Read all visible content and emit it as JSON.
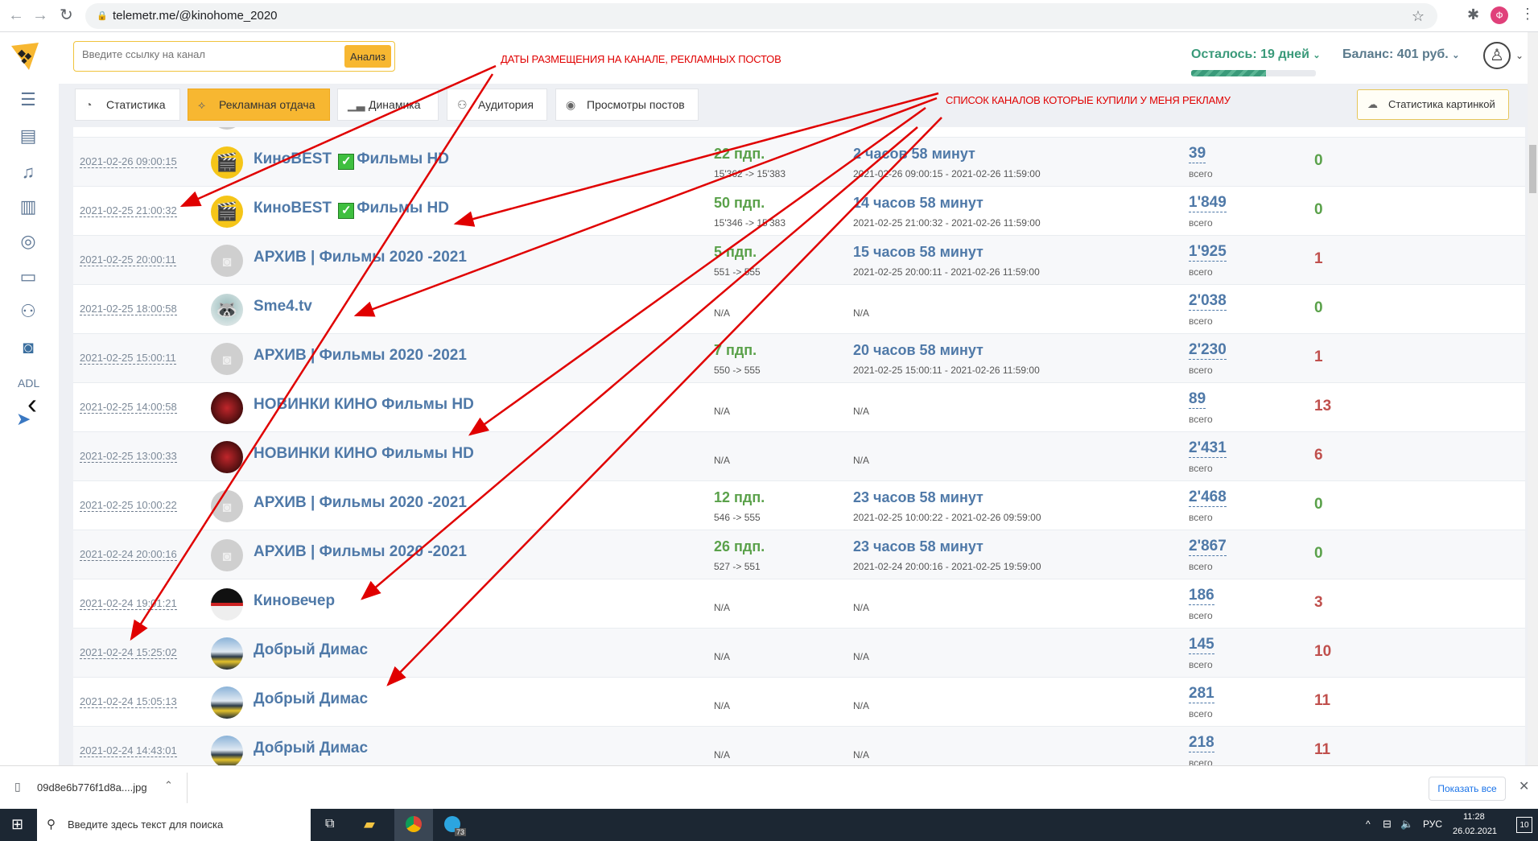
{
  "browser": {
    "url": "telemetr.me/@kinohome_2020",
    "profile_initial": "Ф"
  },
  "sidebar": {
    "icons": [
      "list-icon",
      "clipboard-icon",
      "bell-icon",
      "inbox-archive-icon",
      "user-circle-icon",
      "tray-icon",
      "users-icon",
      "instagram-icon"
    ],
    "adl_label": "ADL"
  },
  "header": {
    "search_placeholder": "Введите ссылку на канал",
    "analyze_label": "Анализ",
    "days_left": "Осталось: 19 дней",
    "days_progress_percent": 60,
    "balance": "Баланс: 401 руб."
  },
  "tabs": [
    {
      "label": "Статистика",
      "icon": "speedometer-icon"
    },
    {
      "label": "Рекламная отдача",
      "icon": "network-icon",
      "active": true
    },
    {
      "label": "Динамика",
      "icon": "chart-icon"
    },
    {
      "label": "Аудитория",
      "icon": "audience-icon"
    },
    {
      "label": "Просмотры постов",
      "icon": "eye-icon"
    }
  ],
  "image_stats_button": "Статистика картинкой",
  "views_sublabel": "всего",
  "na": "N/A",
  "rows": [
    {
      "date": "2021-02-26 09:00:15",
      "name_a": "КиноBEST",
      "check": true,
      "name_b": "Фильмы HD",
      "avatar": "clapper",
      "subs": "22 пдп.",
      "subs_detail": "15'362 -> 15'383",
      "duration": "2 часов 58 минут",
      "period": "2021-02-26 09:00:15 - 2021-02-26 11:59:00",
      "views": "39",
      "count": "0",
      "count_color": "green"
    },
    {
      "date": "2021-02-25 21:00:32",
      "name_a": "КиноBEST",
      "check": true,
      "name_b": "Фильмы HD",
      "avatar": "clapper",
      "subs": "50 пдп.",
      "subs_detail": "15'346 -> 15'383",
      "duration": "14 часов 58 минут",
      "period": "2021-02-25 21:00:32 - 2021-02-26 11:59:00",
      "views": "1'849",
      "count": "0",
      "count_color": "green"
    },
    {
      "date": "2021-02-25 20:00:11",
      "name_a": "АРХИВ | Фильмы 2020 -2021",
      "avatar": "camera",
      "subs": "5 пдп.",
      "subs_detail": "551 -> 555",
      "duration": "15 часов 58 минут",
      "period": "2021-02-25 20:00:11 - 2021-02-26 11:59:00",
      "views": "1'925",
      "count": "1",
      "count_color": "red"
    },
    {
      "date": "2021-02-25 18:00:58",
      "name_a": "Sme4.tv",
      "avatar": "raccoon",
      "views": "2'038",
      "count": "0",
      "count_color": "green"
    },
    {
      "date": "2021-02-25 15:00:11",
      "name_a": "АРХИВ | Фильмы 2020 -2021",
      "avatar": "camera",
      "subs": "7 пдп.",
      "subs_detail": "550 -> 555",
      "duration": "20 часов 58 минут",
      "period": "2021-02-25 15:00:11 - 2021-02-26 11:59:00",
      "views": "2'230",
      "count": "1",
      "count_color": "red"
    },
    {
      "date": "2021-02-25 14:00:58",
      "name_a": "НОВИНКИ КИНО Фильмы HD",
      "avatar": "hero",
      "views": "89",
      "count": "13",
      "count_color": "red"
    },
    {
      "date": "2021-02-25 13:00:33",
      "name_a": "НОВИНКИ КИНО Фильмы HD",
      "avatar": "hero",
      "views": "2'431",
      "count": "6",
      "count_color": "red"
    },
    {
      "date": "2021-02-25 10:00:22",
      "name_a": "АРХИВ | Фильмы 2020 -2021",
      "avatar": "camera",
      "subs": "12 пдп.",
      "subs_detail": "546 -> 555",
      "duration": "23 часов 58 минут",
      "period": "2021-02-25 10:00:22 - 2021-02-26 09:59:00",
      "views": "2'468",
      "count": "0",
      "count_color": "green"
    },
    {
      "date": "2021-02-24 20:00:16",
      "name_a": "АРХИВ | Фильмы 2020 -2021",
      "avatar": "camera",
      "subs": "26 пдп.",
      "subs_detail": "527 -> 551",
      "duration": "23 часов 58 минут",
      "period": "2021-02-24 20:00:16 - 2021-02-25 19:59:00",
      "views": "2'867",
      "count": "0",
      "count_color": "green"
    },
    {
      "date": "2021-02-24 19:01:21",
      "name_a": "Киновечер",
      "avatar": "popcorn",
      "views": "186",
      "count": "3",
      "count_color": "red"
    },
    {
      "date": "2021-02-24 15:25:02",
      "name_a": "Добрый Димас",
      "avatar": "mountain",
      "views": "145",
      "count": "10",
      "count_color": "red"
    },
    {
      "date": "2021-02-24 15:05:13",
      "name_a": "Добрый Димас",
      "avatar": "mountain",
      "views": "281",
      "count": "11",
      "count_color": "red"
    },
    {
      "date": "2021-02-24 14:43:01",
      "name_a": "Добрый Димас",
      "avatar": "mountain",
      "views": "218",
      "count": "11",
      "count_color": "red"
    }
  ],
  "annotations": {
    "dates_note": "ДАТЫ РАЗМЕЩЕНИЯ НА КАНАЛЕ, РЕКЛАМНЫХ ПОСТОВ",
    "channels_note": "СПИСОК КАНАЛОВ КОТОРЫЕ КУПИЛИ У МЕНЯ РЕКЛАМУ"
  },
  "downloads": {
    "file": "09d8e6b776f1d8a....jpg",
    "show_all": "Показать все"
  },
  "taskbar": {
    "search_placeholder": "Введите здесь текст для поиска",
    "lang": "РУС",
    "time": "11:28",
    "date": "26.02.2021",
    "telegram_badge": "73",
    "notif_count": "10"
  },
  "colors": {
    "accent": "#f7b731",
    "link": "#4f79a8",
    "green": "#5aa14a",
    "red": "#c0504d",
    "progress": "#3a9a7a"
  }
}
